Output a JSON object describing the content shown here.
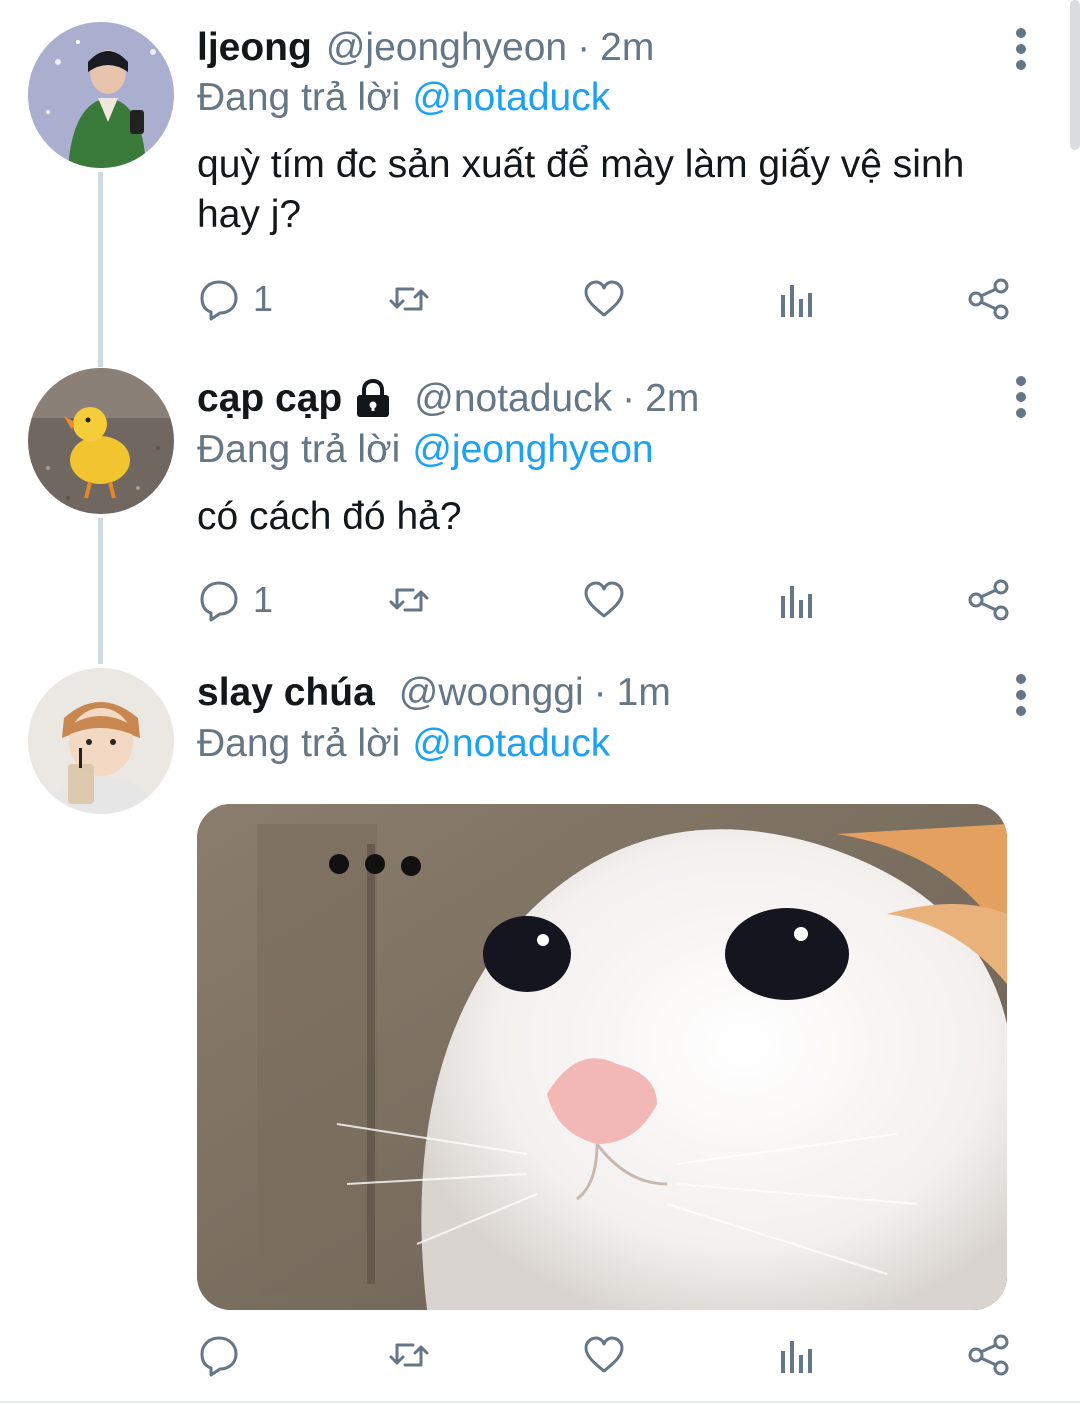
{
  "tweets": [
    {
      "display_name": "ljeong",
      "handle": "@jeonghyeon",
      "separator": "·",
      "time": "2m",
      "replying_prefix": "Đang trả lời",
      "replying_to": "@notaduck",
      "text": "quỳ tím đc sản xuất để mày làm giấy vệ sinh hay j?",
      "reply_count": "1",
      "locked": false
    },
    {
      "display_name": "cạp cạp",
      "handle": "@notaduck",
      "separator": "·",
      "time": "2m",
      "replying_prefix": "Đang trả lời",
      "replying_to": "@jeonghyeon",
      "text": "có cách đó hả?",
      "reply_count": "1",
      "locked": true
    },
    {
      "display_name": "slay chúa",
      "handle": "@woonggi",
      "separator": "·",
      "time": "1m",
      "replying_prefix": "Đang trả lời",
      "replying_to": "@notaduck",
      "text": "",
      "reply_count": "",
      "locked": false,
      "media": "cat-photo"
    }
  ],
  "icons": {
    "reply": "reply-icon",
    "retweet": "retweet-icon",
    "like": "heart-icon",
    "analytics": "analytics-icon",
    "share": "share-icon",
    "more": "more-vertical-icon",
    "lock": "lock-icon"
  },
  "colors": {
    "link": "#1da1f2",
    "secondary_text": "#657786",
    "primary_text": "#14171a",
    "thread_line": "#cfd9de"
  }
}
